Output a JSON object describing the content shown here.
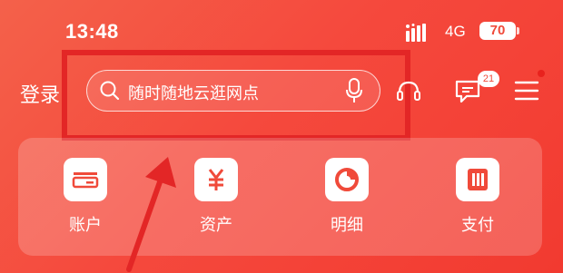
{
  "status": {
    "time": "13:48",
    "network": "4G",
    "battery": "70"
  },
  "header": {
    "login_label": "登录",
    "search_placeholder": "随时随地云逛网点",
    "message_badge": "21"
  },
  "quick_actions": [
    {
      "label": "账户",
      "icon": "account-card-icon"
    },
    {
      "label": "资产",
      "icon": "yuan-asset-icon"
    },
    {
      "label": "明细",
      "icon": "pie-detail-icon"
    },
    {
      "label": "支付",
      "icon": "payment-icon"
    }
  ],
  "colors": {
    "accent": "#f04a3a",
    "highlight": "#e32626"
  }
}
